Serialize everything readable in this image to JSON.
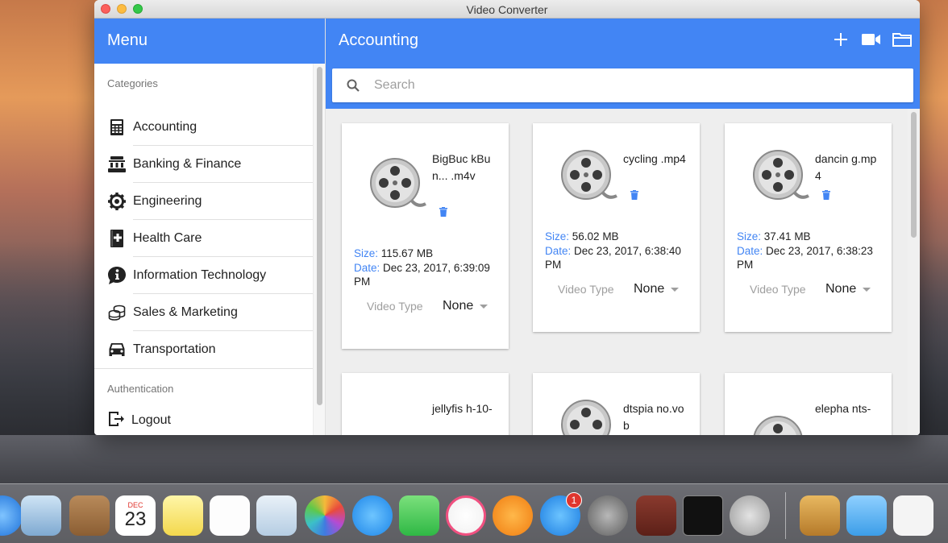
{
  "window": {
    "title": "Video Converter"
  },
  "sidebar": {
    "header": "Menu",
    "categories_title": "Categories",
    "categories": [
      {
        "label": "Accounting",
        "icon": "calculator-icon"
      },
      {
        "label": "Banking & Finance",
        "icon": "bank-icon"
      },
      {
        "label": "Engineering",
        "icon": "gear-icon"
      },
      {
        "label": "Health Care",
        "icon": "medical-book-icon"
      },
      {
        "label": "Information Technology",
        "icon": "info-icon"
      },
      {
        "label": "Sales & Marketing",
        "icon": "coins-icon"
      },
      {
        "label": "Transportation",
        "icon": "car-icon"
      }
    ],
    "authentication_title": "Authentication",
    "logout_label": "Logout"
  },
  "main": {
    "title": "Accounting",
    "actions": [
      "add-icon",
      "video-camera-icon",
      "folder-icon"
    ],
    "search_placeholder": "Search",
    "cards": [
      {
        "filename": "BigBuc kBun... .m4v",
        "size_label": "Size:",
        "size": "115.67 MB",
        "date_label": "Date:",
        "date": "Dec 23, 2017, 6:39:09 PM",
        "video_type_label": "Video Type",
        "video_type": "None"
      },
      {
        "filename": "cycling .mp4",
        "size_label": "Size:",
        "size": "56.02 MB",
        "date_label": "Date:",
        "date": "Dec 23, 2017, 6:38:40 PM",
        "video_type_label": "Video Type",
        "video_type": "None"
      },
      {
        "filename": "dancin g.mp4",
        "size_label": "Size:",
        "size": "37.41 MB",
        "date_label": "Date:",
        "date": "Dec 23, 2017, 6:38:23 PM",
        "video_type_label": "Video Type",
        "video_type": "None"
      },
      {
        "filename": "jellyfis h-10-"
      },
      {
        "filename": "dtspia no.vob"
      },
      {
        "filename": "elepha nts-"
      }
    ]
  },
  "dock": {
    "calendar_month": "DEC",
    "calendar_day": "23",
    "app_store_badge": "1",
    "colors": {
      "accent": "#4285f4",
      "delete": "#4285f4"
    }
  }
}
